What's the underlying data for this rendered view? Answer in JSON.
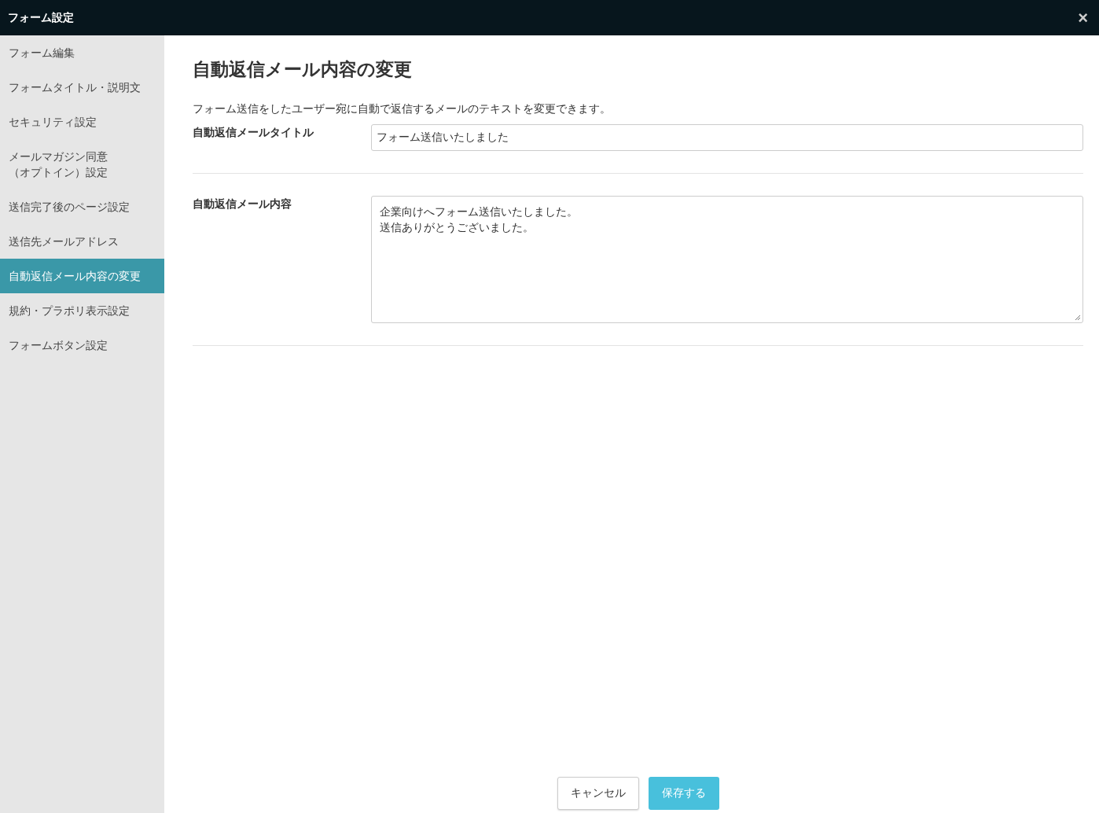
{
  "window": {
    "title": "フォーム設定",
    "close": "×"
  },
  "sidebar": {
    "items": [
      {
        "label": "フォーム編集",
        "selected": false
      },
      {
        "label": "フォームタイトル・説明文",
        "selected": false
      },
      {
        "label": "セキュリティ設定",
        "selected": false
      },
      {
        "label": "メールマガジン同意",
        "label_line_2": "（オプトイン）設定",
        "selected": false
      },
      {
        "label": "送信完了後のページ設定",
        "selected": false
      },
      {
        "label": "送信先メールアドレス",
        "selected": false
      },
      {
        "label": "自動返信メール内容の変更",
        "selected": true
      },
      {
        "label": "規約・プラポリ表示設定",
        "selected": false
      },
      {
        "label": "フォームボタン設定",
        "selected": false
      }
    ]
  },
  "heading": "自動返信メール内容の変更",
  "description": "フォーム送信をしたユーザー宛に自動で返信するメールのテキストを変更できます。",
  "fields": [
    {
      "kind": "input",
      "label": "自動返信メールタイトル",
      "value": "フォーム送信いたしました"
    },
    {
      "kind": "textarea",
      "label": "自動返信メール内容",
      "lines": [
        "企業向けへフォーム送信いたしました。",
        "送信ありがとうございました。"
      ]
    }
  ],
  "buttons": {
    "cancel": "キャンセル",
    "save": "保存する"
  }
}
